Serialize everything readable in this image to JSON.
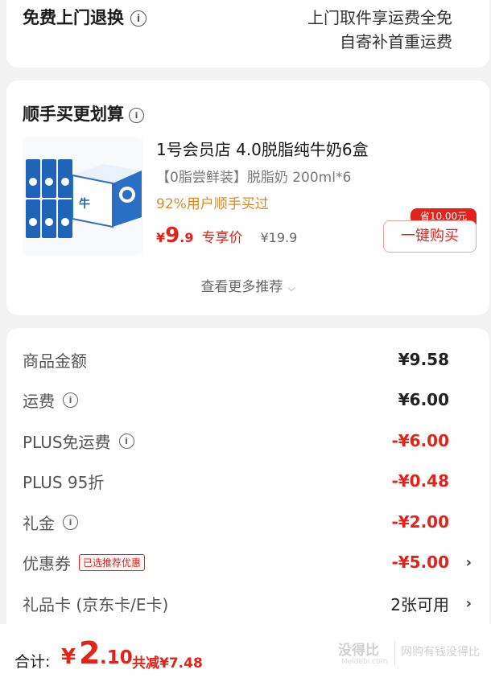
{
  "return_service": {
    "title": "免费上门退换",
    "desc_line1": "上门取件享运费全免",
    "desc_line2": "自寄补首重运费"
  },
  "addon": {
    "title": "顺手买更划算",
    "product": {
      "name": "1号会员店 4.0脱脂纯牛奶6盒",
      "spec": "【0脂尝鲜装】脱脂奶 200ml*6",
      "buyers": "92%用户顺手买过",
      "price_currency": "¥",
      "price_int": "9",
      "price_dec": ".9",
      "price_tag": "专享价",
      "orig_price": "¥19.9",
      "save_badge": "省10.00元",
      "buy_label": "一键购买"
    },
    "see_more": "查看更多推荐"
  },
  "summary": {
    "rows": [
      {
        "label": "商品金额",
        "value": "¥9.58"
      },
      {
        "label": "运费",
        "value": "¥6.00"
      },
      {
        "label": "PLUS免运费",
        "value": "-¥6.00"
      },
      {
        "label": "PLUS 95折",
        "value": "-¥0.48"
      },
      {
        "label": "礼金",
        "value": "-¥2.00"
      },
      {
        "label": "优惠券",
        "badge": "已选推荐优惠",
        "value": "-¥5.00"
      },
      {
        "label": "礼品卡 (京东卡/E卡)",
        "value": "2张可用"
      }
    ]
  },
  "bottom": {
    "total_label": "合计:",
    "total_currency": "¥",
    "total_int": "2",
    "total_dec": ".10",
    "total_discount": "共减¥7.48"
  },
  "watermark": {
    "logo": "没得比",
    "sub": "Meidebi.com",
    "slogan": "网购有钱没得比"
  },
  "colors": {
    "accent": "#e2231a",
    "orange": "#d9892a",
    "background": "#f2f2f2"
  }
}
